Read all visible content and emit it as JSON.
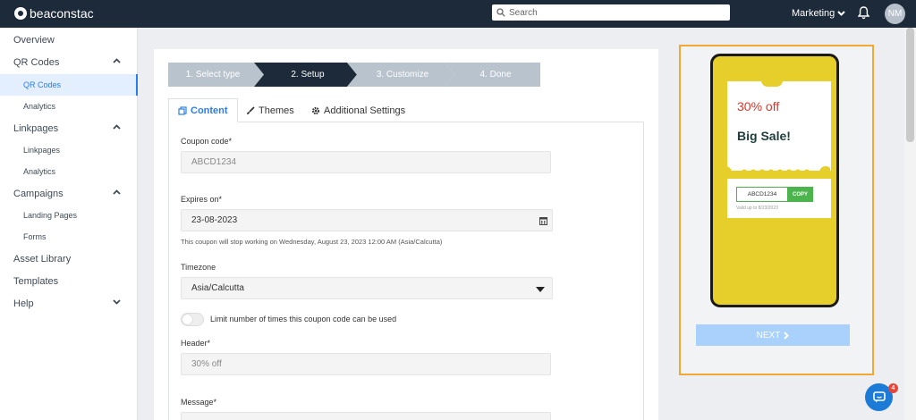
{
  "app": {
    "brand": "beaconstac"
  },
  "header": {
    "search_placeholder": "Search",
    "org_name": "Marketing",
    "avatar_initials": "NM"
  },
  "sidebar": {
    "items": [
      {
        "label": "Overview"
      },
      {
        "label": "QR Codes"
      },
      {
        "label": "QR Codes"
      },
      {
        "label": "Analytics"
      },
      {
        "label": "Linkpages"
      },
      {
        "label": "Linkpages"
      },
      {
        "label": "Analytics"
      },
      {
        "label": "Campaigns"
      },
      {
        "label": "Landing Pages"
      },
      {
        "label": "Forms"
      },
      {
        "label": "Asset Library"
      },
      {
        "label": "Templates"
      },
      {
        "label": "Help"
      }
    ]
  },
  "steps": [
    {
      "label": "1. Select type",
      "state": "done"
    },
    {
      "label": "2. Setup",
      "state": "active"
    },
    {
      "label": "3. Customize",
      "state": "pending"
    },
    {
      "label": "4. Done",
      "state": "pending"
    }
  ],
  "tabs": [
    {
      "label": "Content"
    },
    {
      "label": "Themes"
    },
    {
      "label": "Additional Settings"
    }
  ],
  "form": {
    "coupon_code_label": "Coupon code*",
    "coupon_code_value": "ABCD1234",
    "expires_label": "Expires on*",
    "expires_value": "23-08-2023",
    "expires_help": "This coupon will stop working on Wednesday, August 23, 2023 12:00 AM (Asia/Calcutta)",
    "timezone_label": "Timezone",
    "timezone_value": "Asia/Calcutta",
    "limit_toggle_label": "Limit number of times this coupon code can be used",
    "header_label": "Header*",
    "header_value": "30% off",
    "message_label": "Message*"
  },
  "preview": {
    "offer": "30% off",
    "title": "Big Sale!",
    "code": "ABCD1234",
    "copy_label": "COPY",
    "valid_text": "Valid up to 8/23/2023",
    "next_label": "NEXT"
  },
  "chat": {
    "badge_count": "4"
  },
  "colors": {
    "topbar": "#1d2a3a",
    "accent": "#2b7de9",
    "step_done": "#b9c3ce",
    "step_active": "#1d2a3a",
    "coupon_bg": "#e6cf2a",
    "preview_border": "#f0a934"
  }
}
